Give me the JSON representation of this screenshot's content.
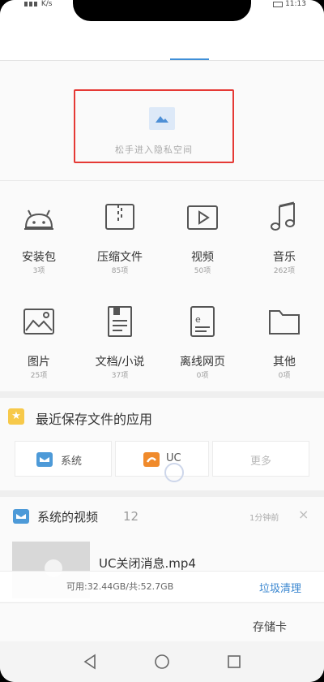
{
  "status": {
    "network": "K/s",
    "time": "11:13"
  },
  "private_space": {
    "label": "松手进入隐私空间"
  },
  "categories": [
    {
      "label": "安装包",
      "count": "3项",
      "icon": "android-icon"
    },
    {
      "label": "压缩文件",
      "count": "85项",
      "icon": "zip-icon"
    },
    {
      "label": "视频",
      "count": "50项",
      "icon": "video-icon"
    },
    {
      "label": "音乐",
      "count": "262项",
      "icon": "music-icon"
    },
    {
      "label": "图片",
      "count": "25项",
      "icon": "image-icon"
    },
    {
      "label": "文档/小说",
      "count": "37项",
      "icon": "document-icon"
    },
    {
      "label": "离线网页",
      "count": "0项",
      "icon": "offline-page-icon"
    },
    {
      "label": "其他",
      "count": "0项",
      "icon": "folder-icon"
    }
  ],
  "recent_apps": {
    "title": "最近保存文件的应用",
    "apps": [
      {
        "label": "系统",
        "color": "#4d9ad8"
      },
      {
        "label": "UC",
        "color": "#f08a2b"
      },
      {
        "label": "更多"
      }
    ]
  },
  "system_videos": {
    "title": "系统的视频",
    "count": "12",
    "time": "1分钟前",
    "file_name": "UC关闭消息.mp4"
  },
  "storage": {
    "text": "可用:32.44GB/共:52.7GB",
    "clean_label": "垃圾清理",
    "sd_label": "存储卡"
  },
  "colors": {
    "accent": "#3f8fd8",
    "highlight_box": "#e53935",
    "star": "#f7c94a"
  }
}
